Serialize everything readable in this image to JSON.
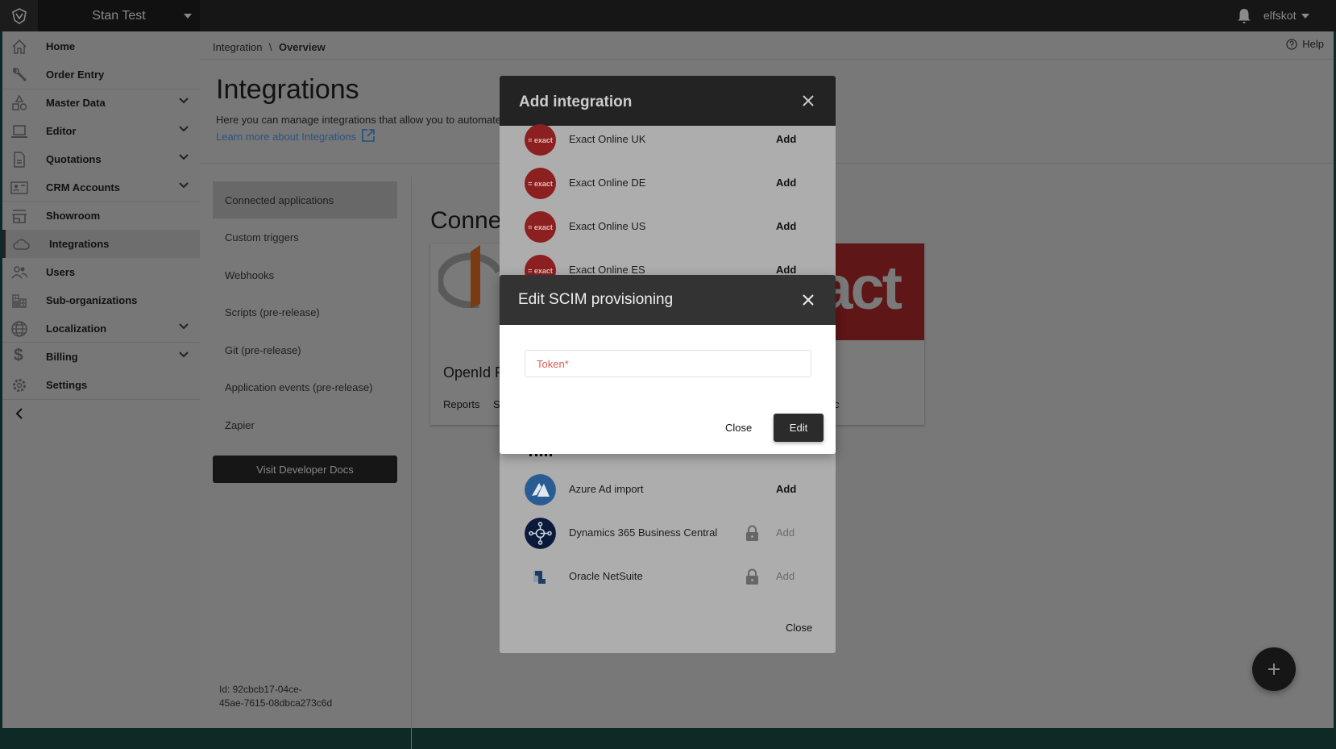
{
  "topbar": {
    "workspace": "Stan Test",
    "user": "elfskot"
  },
  "sidebar": {
    "items": [
      {
        "label": "Home",
        "icon": "home-icon"
      },
      {
        "label": "Order Entry",
        "icon": "wrench-icon"
      },
      {
        "label": "Master Data",
        "icon": "shapes-icon",
        "expandable": true
      },
      {
        "label": "Editor",
        "icon": "laptop-icon",
        "expandable": true
      },
      {
        "label": "Quotations",
        "icon": "document-icon",
        "expandable": true
      },
      {
        "label": "CRM Accounts",
        "icon": "contact-card-icon",
        "expandable": true
      },
      {
        "label": "Showroom",
        "icon": "store-icon"
      },
      {
        "label": "Integrations",
        "icon": "cloud-icon",
        "active": true
      },
      {
        "label": "Users",
        "icon": "users-icon"
      },
      {
        "label": "Sub-organizations",
        "icon": "building-icon"
      },
      {
        "label": "Localization",
        "icon": "globe-icon",
        "expandable": true
      },
      {
        "label": "Billing",
        "icon": "dollar-icon",
        "expandable": true
      },
      {
        "label": "Settings",
        "icon": "gear-icon"
      }
    ]
  },
  "breadcrumb": {
    "parent": "Integration",
    "separator": "\\",
    "current": "Overview"
  },
  "help": "Help",
  "page": {
    "title": "Integrations",
    "subtitle": "Here you can manage integrations that allow you to automate",
    "link": "Learn more about Integrations"
  },
  "submenu": {
    "items": [
      "Connected applications",
      "Custom triggers",
      "Webhooks",
      "Scripts (pre-release)",
      "Git (pre-release)",
      "Application events (pre-release)",
      "Zapier"
    ],
    "docs_button": "Visit Developer Docs"
  },
  "connected": {
    "heading": "Connec",
    "card1_title": "OpenId F",
    "card1_links": [
      "Reports",
      "S"
    ],
    "card2_logo": "act",
    "card2_link_fragment": "c"
  },
  "id_text": {
    "line1": "Id: 92cbcb17-04ce-",
    "line2": "45ae-7615-08dbca273c6d"
  },
  "add_modal": {
    "title": "Add integration",
    "close_label": "Close",
    "rows": [
      {
        "name": "Exact Online UK",
        "add": "Add",
        "locked": false,
        "logo": "= exact"
      },
      {
        "name": "Exact Online DE",
        "add": "Add",
        "locked": false,
        "logo": "= exact"
      },
      {
        "name": "Exact Online US",
        "add": "Add",
        "locked": false,
        "logo": "= exact"
      },
      {
        "name": "Exact Online ES",
        "add": "Add",
        "locked": false,
        "logo": "= exact"
      },
      {
        "name": "Azure Ad import",
        "add": "Add",
        "locked": false
      },
      {
        "name": "Dynamics 365 Business Central",
        "add": "Add",
        "locked": true
      },
      {
        "name": "Oracle NetSuite",
        "add": "Add",
        "locked": true
      }
    ]
  },
  "scim_modal": {
    "title": "Edit SCIM provisioning",
    "token_placeholder": "Token*",
    "close_label": "Close",
    "edit_label": "Edit"
  },
  "colors": {
    "exact_red": "#8c1f1f",
    "azure_blue": "#2a5c94",
    "dynamics_navy": "#0b1a3a",
    "token_label": "#e05a4e"
  }
}
